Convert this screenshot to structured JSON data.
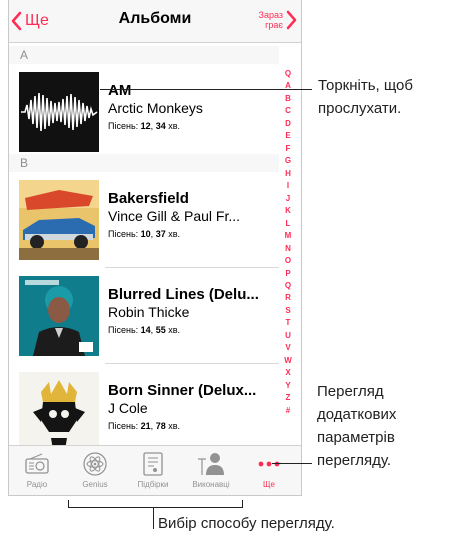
{
  "nav": {
    "back_label": "Ще",
    "title": "Альбоми",
    "now_playing_line1": "Зараз",
    "now_playing_line2": "грає"
  },
  "sections": [
    {
      "letter": "A"
    },
    {
      "letter": "B"
    }
  ],
  "albums": [
    {
      "title": "AM",
      "artist": "Arctic Monkeys",
      "songs_label": "Пісень:",
      "songs": "12",
      "minutes": "34",
      "minutes_unit": "хв."
    },
    {
      "title": "Bakersfield",
      "artist": "Vince Gill & Paul Fr...",
      "songs_label": "Пісень:",
      "songs": "10",
      "minutes": "37",
      "minutes_unit": "хв."
    },
    {
      "title": "Blurred Lines (Delu...",
      "artist": "Robin Thicke",
      "songs_label": "Пісень:",
      "songs": "14",
      "minutes": "55",
      "minutes_unit": "хв."
    },
    {
      "title": "Born Sinner (Delux...",
      "artist": "J Cole",
      "songs_label": "Пісень:",
      "songs": "21",
      "minutes": "78",
      "minutes_unit": "хв."
    }
  ],
  "index_letters": [
    "Q",
    "A",
    "B",
    "C",
    "D",
    "E",
    "F",
    "G",
    "H",
    "I",
    "J",
    "K",
    "L",
    "M",
    "N",
    "O",
    "P",
    "Q",
    "R",
    "S",
    "T",
    "U",
    "V",
    "W",
    "X",
    "Y",
    "Z",
    "#"
  ],
  "tabs": [
    {
      "label": "Радіо",
      "icon": "radio-icon"
    },
    {
      "label": "Genius",
      "icon": "genius-atom-icon"
    },
    {
      "label": "Підбірки",
      "icon": "playlist-icon"
    },
    {
      "label": "Виконавці",
      "icon": "artist-mic-icon"
    },
    {
      "label": "Ще",
      "icon": "more-dots-icon"
    }
  ],
  "callouts": {
    "tap_line1": "Торкніть, щоб",
    "tap_line2": "прослухати.",
    "more_line1": "Перегляд",
    "more_line2": "додаткових",
    "more_line3": "параметрів",
    "more_line4": "перегляду.",
    "choose": "Вибір способу перегляду."
  },
  "colors": {
    "accent": "#ff2d55",
    "tab_inactive": "#929292"
  }
}
